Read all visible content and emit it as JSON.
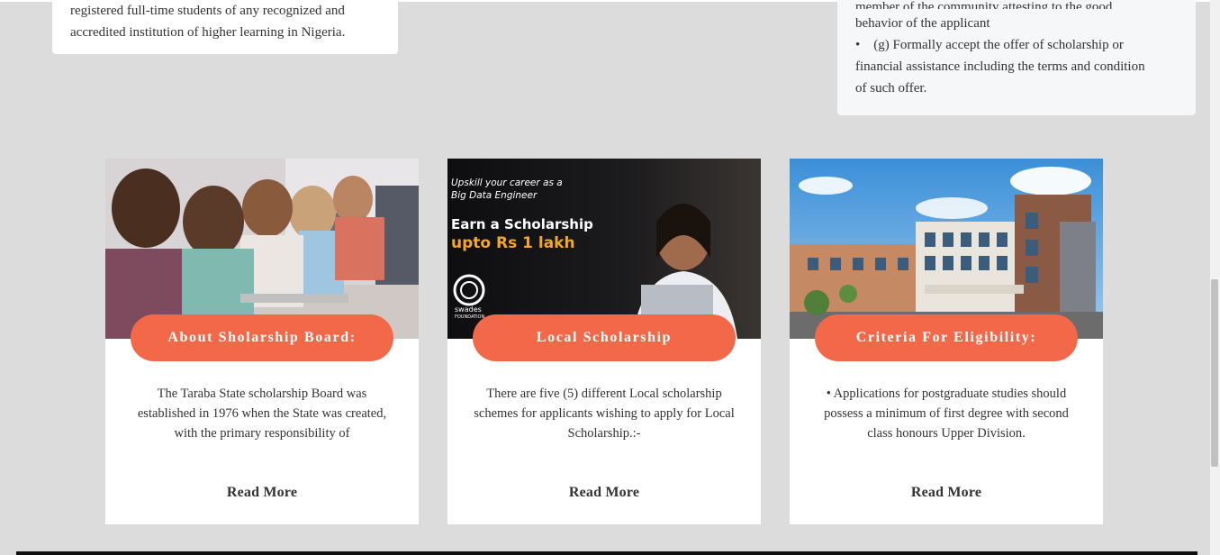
{
  "top_left_card": {
    "text": "registered full-time students of any recognized and accredited institution of higher learning in Nigeria."
  },
  "top_right_card": {
    "cut_line": "member of the community attesting to the good",
    "line1": "behavior of the applicant",
    "line2": "(g) Formally accept the offer of scholarship or",
    "line3": "financial assistance including the terms and condition",
    "line4": "of such offer."
  },
  "cards": [
    {
      "title": "About Sholarship Board:",
      "description": "The Taraba State scholarship Board was established in 1976 when the State was created, with the primary responsibility of",
      "read_more": "Read More"
    },
    {
      "title": "Local Scholarship",
      "description": "There are five (5) different Local scholarship schemes for applicants wishing to apply for Local Scholarship.:-",
      "read_more": "Read More",
      "banner": {
        "small1": "Upskill your career as a",
        "small2": "Big Data Engineer",
        "big1": "Earn a Scholarship",
        "big2": "upto Rs 1 lakh",
        "logo": "swades",
        "logo_sub": "FOUNDATION"
      }
    },
    {
      "title": "Criteria For Eligibility:",
      "description": "• Applications for postgraduate studies should possess a minimum of first degree with second class honours Upper Division.",
      "read_more": "Read More"
    }
  ],
  "colors": {
    "accent": "#f4684a",
    "page_bg": "#dcdcdc"
  }
}
